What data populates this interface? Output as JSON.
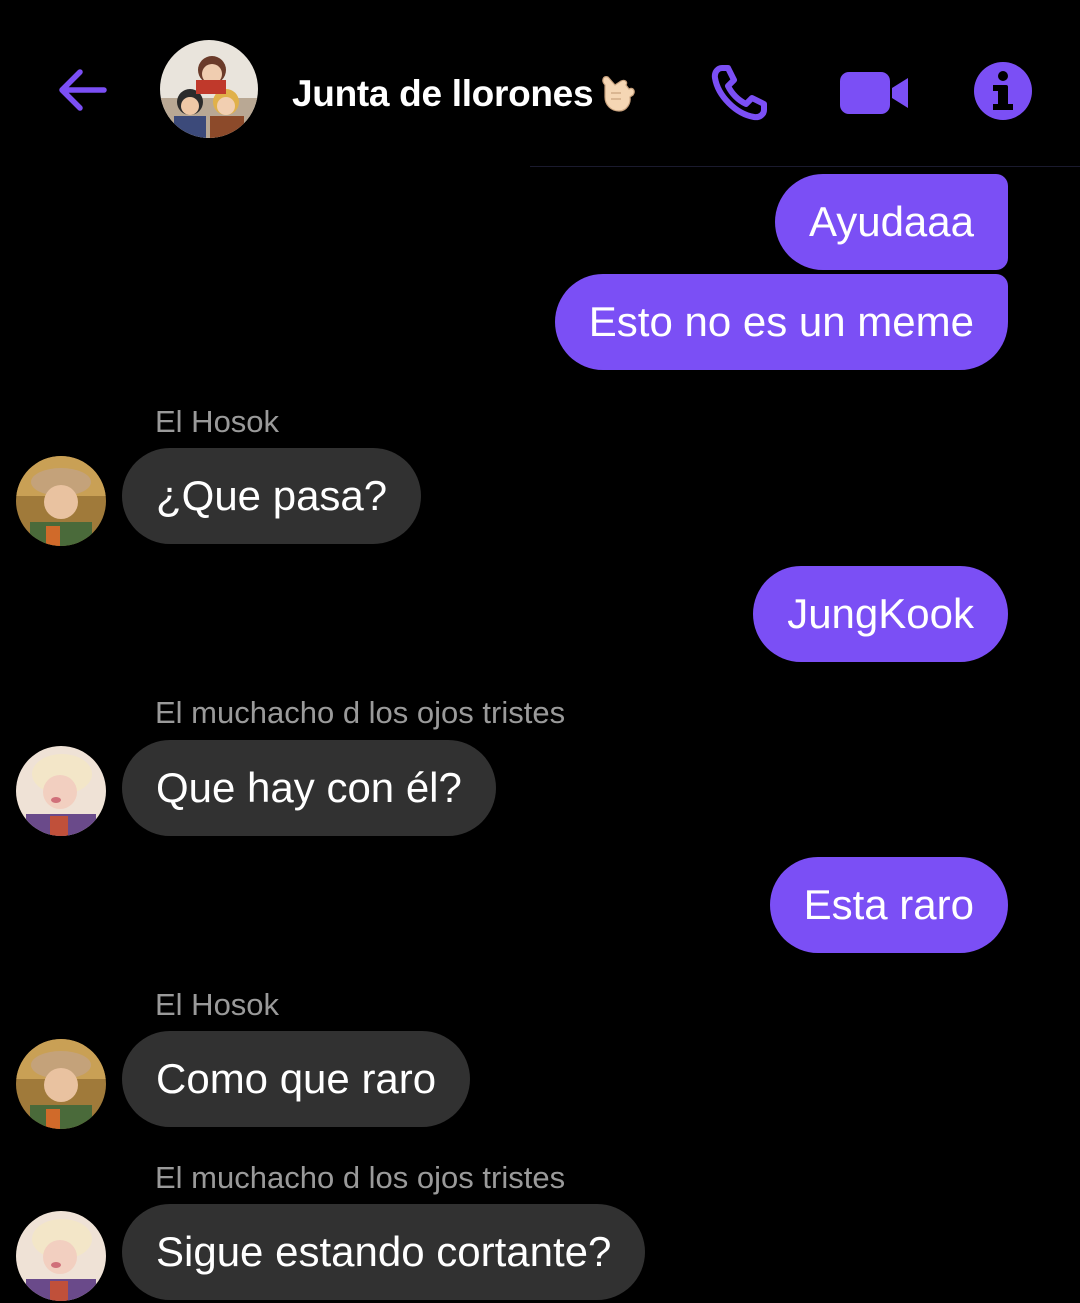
{
  "header": {
    "back_icon": "arrow-left-icon",
    "title": "Junta de llorones",
    "title_emoji": "call-me-hand-emoji",
    "call_icon": "phone-icon",
    "video_icon": "video-camera-icon",
    "info_icon": "info-icon",
    "accent_color": "#7b4ff5"
  },
  "messages": {
    "m1": {
      "text": "Ayudaaa"
    },
    "m2": {
      "text": "Esto no es un meme"
    },
    "m3": {
      "sender": "El Hosok",
      "text": "¿Que pasa?"
    },
    "m4": {
      "text": "JungKook"
    },
    "m5": {
      "sender": "El muchacho d los ojos tristes",
      "text": "Que hay con él?"
    },
    "m6": {
      "text": "Esta raro"
    },
    "m7": {
      "sender": "El Hosok",
      "text": "Como que raro"
    },
    "m8": {
      "sender": "El muchacho d los ojos tristes",
      "text": "Sigue estando cortante?"
    }
  },
  "colors": {
    "background": "#000000",
    "outgoing_bubble": "#7b4ff5",
    "incoming_bubble": "#313131",
    "sender_text": "#9a9a9a"
  }
}
